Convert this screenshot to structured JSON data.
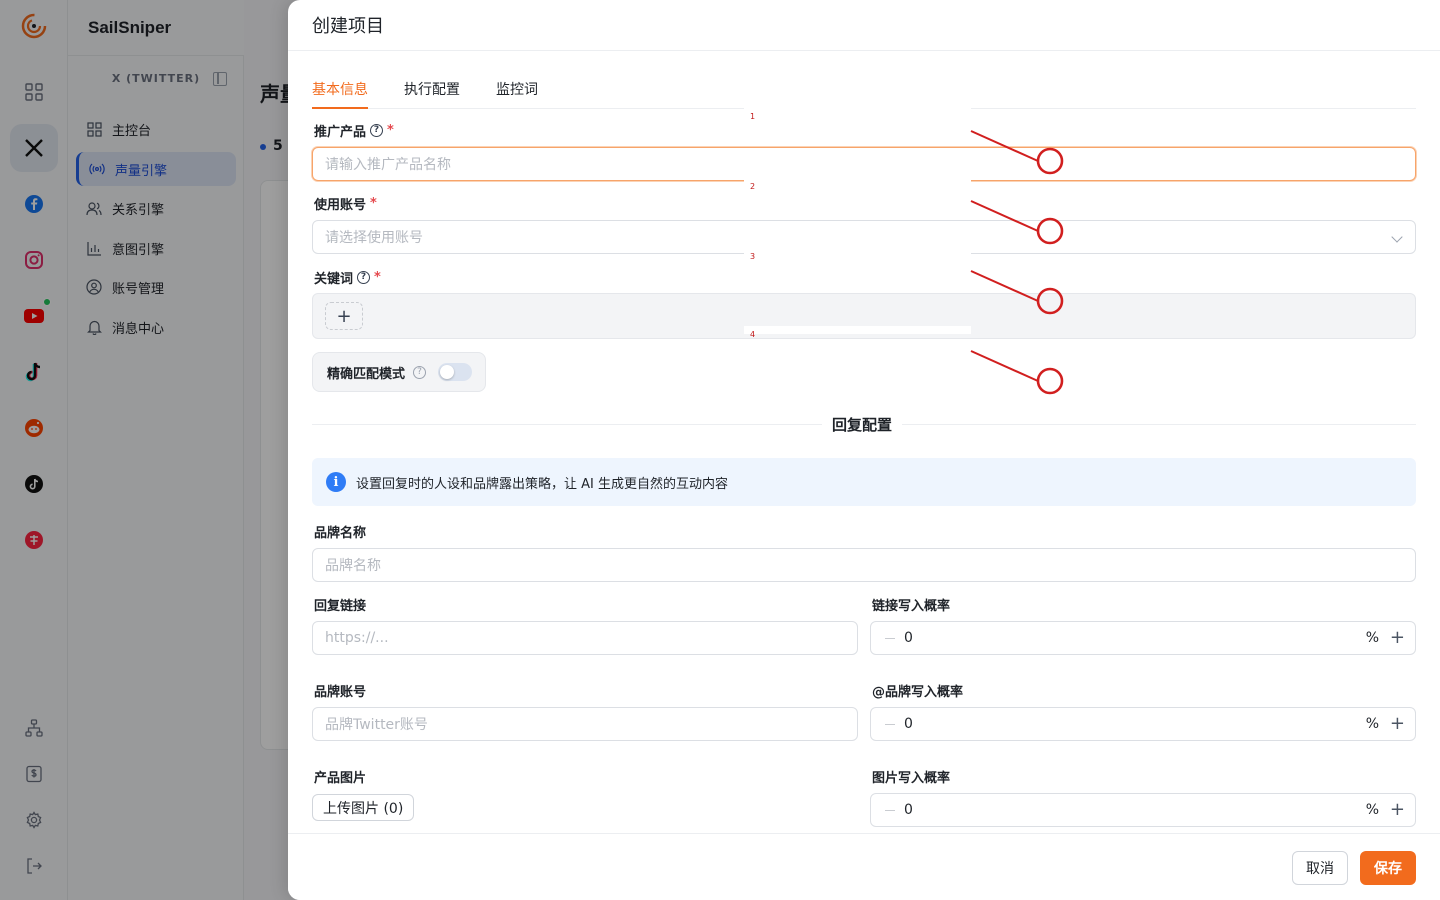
{
  "app": {
    "name": "SailSniper"
  },
  "rail": {
    "colors": {
      "x": "#111111",
      "facebook": "#1877f2",
      "instagram": "#e1306c",
      "youtube": "#ff0000",
      "reddit": "#ff4500",
      "xiaohongshu": "#ff2442"
    }
  },
  "sidebar": {
    "section": "X (TWITTER)",
    "items": [
      {
        "label": "主控台",
        "icon": "dashboard-icon"
      },
      {
        "label": "声量引擎",
        "icon": "broadcast-icon",
        "active": true
      },
      {
        "label": "关系引擎",
        "icon": "users-icon"
      },
      {
        "label": "意图引擎",
        "icon": "bar-chart-icon"
      },
      {
        "label": "账号管理",
        "icon": "account-icon"
      },
      {
        "label": "消息中心",
        "icon": "bell-icon"
      }
    ]
  },
  "background": {
    "title": "声量",
    "count": "5"
  },
  "drawer": {
    "title": "创建项目",
    "tabs": [
      "基本信息",
      "执行配置",
      "监控词"
    ],
    "fields": {
      "product": {
        "label": "推广产品",
        "placeholder": "请输入推广产品名称"
      },
      "account": {
        "label": "使用账号",
        "placeholder": "请选择使用账号"
      },
      "keywords": {
        "label": "关键词"
      },
      "exact_match": {
        "label": "精确匹配模式",
        "enabled": false
      }
    },
    "reply_section": {
      "title": "回复配置",
      "info": "设置回复时的人设和品牌露出策略，让 AI 生成更自然的互动内容",
      "brand_name": {
        "label": "品牌名称",
        "placeholder": "品牌名称"
      },
      "reply_link": {
        "label": "回复链接",
        "placeholder": "https://..."
      },
      "link_prob": {
        "label": "链接写入概率",
        "value": "0",
        "unit": "%"
      },
      "brand_account": {
        "label": "品牌账号",
        "placeholder": "品牌Twitter账号"
      },
      "mention_prob": {
        "label": "@品牌写入概率",
        "value": "0",
        "unit": "%"
      },
      "product_image": {
        "label": "产品图片",
        "upload": "上传图片 (0)"
      },
      "image_prob": {
        "label": "图片写入概率",
        "value": "0",
        "unit": "%"
      }
    },
    "footer": {
      "cancel": "取消",
      "save": "保存"
    },
    "accent_color": "#f26b1d"
  },
  "annotations": [
    "1",
    "2",
    "3",
    "4"
  ]
}
